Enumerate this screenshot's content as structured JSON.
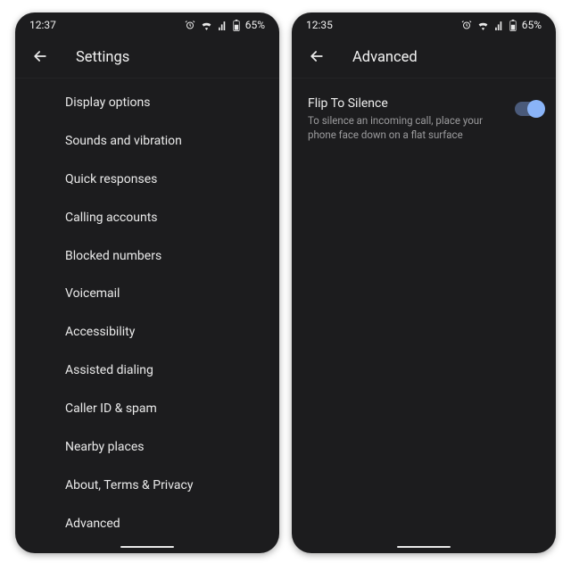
{
  "left": {
    "status": {
      "time": "12:37",
      "battery": "65%"
    },
    "title": "Settings",
    "items": [
      "Display options",
      "Sounds and vibration",
      "Quick responses",
      "Calling accounts",
      "Blocked numbers",
      "Voicemail",
      "Accessibility",
      "Assisted dialing",
      "Caller ID & spam",
      "Nearby places",
      "About, Terms & Privacy",
      "Advanced"
    ]
  },
  "right": {
    "status": {
      "time": "12:35",
      "battery": "65%"
    },
    "title": "Advanced",
    "setting": {
      "title": "Flip To Silence",
      "desc": "To silence an incoming call, place your phone face down on a flat surface",
      "enabled": true
    }
  }
}
